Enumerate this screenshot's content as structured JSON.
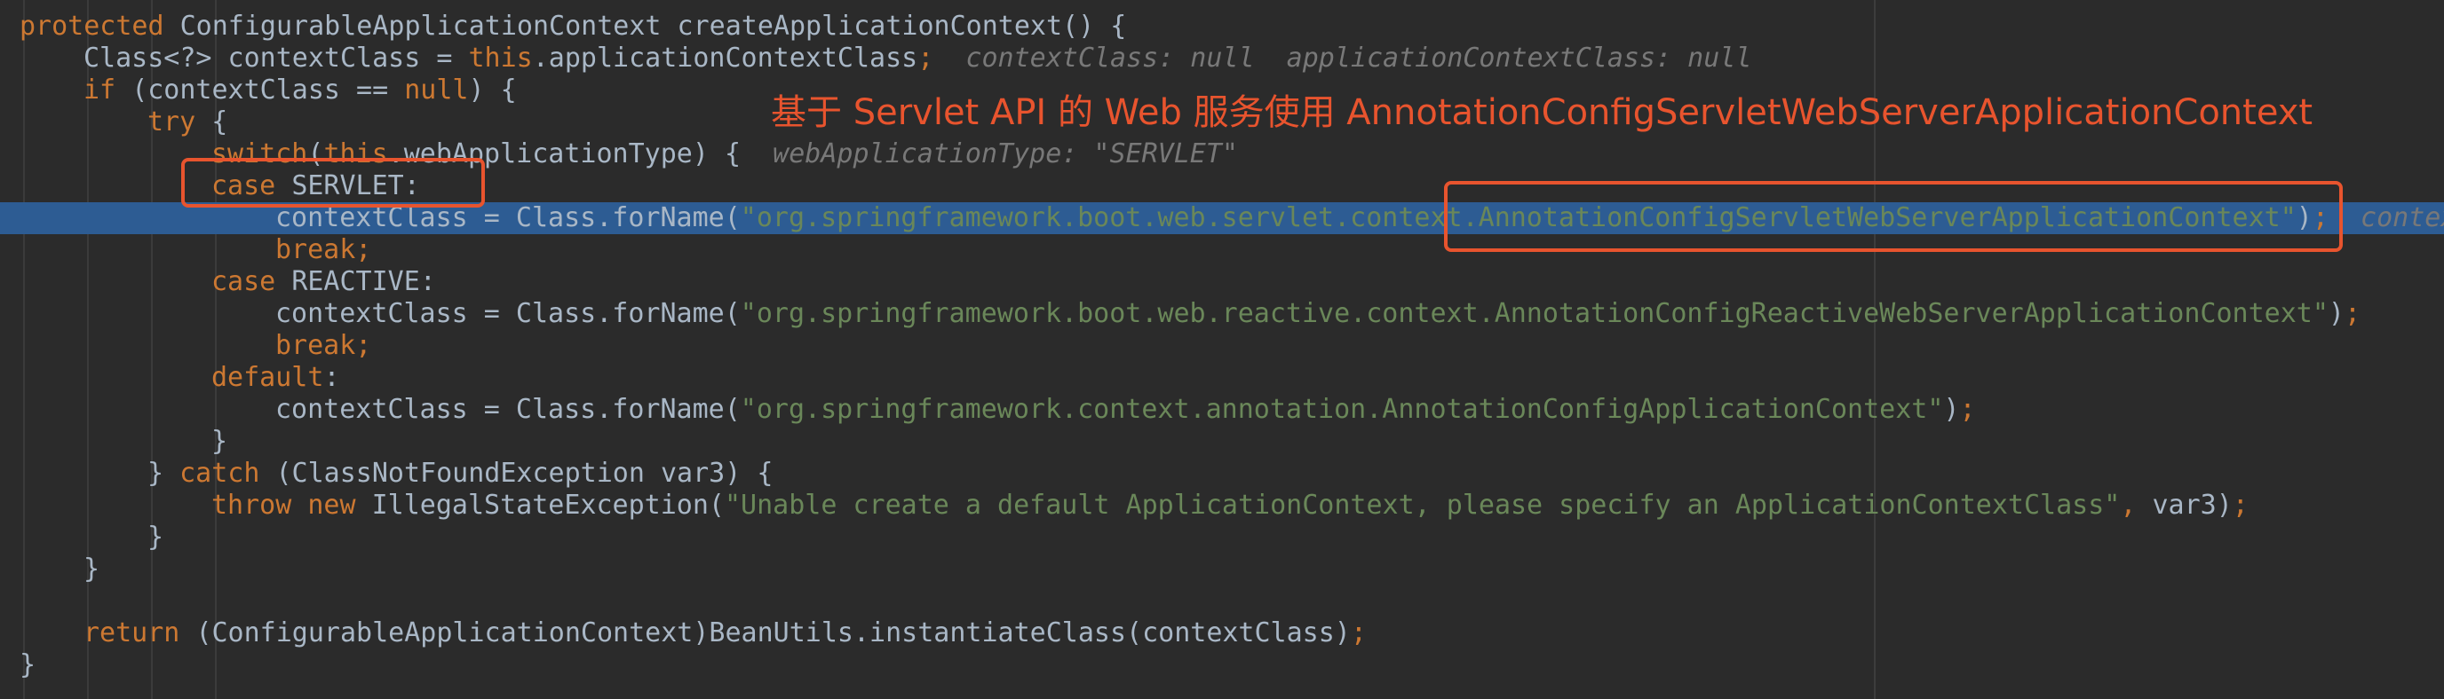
{
  "code_lines": [
    {
      "indent": 0,
      "parts": [
        [
          "kw",
          "protected "
        ],
        [
          "plain",
          "ConfigurableApplicationContext createApplicationContext() {"
        ]
      ]
    },
    {
      "indent": 1,
      "parts": [
        [
          "plain",
          "Class<?> contextClass = "
        ],
        [
          "kw",
          "this"
        ],
        [
          "plain",
          ".applicationContextClass"
        ],
        [
          "kw",
          ";"
        ],
        [
          "hint",
          "  contextClass: null  applicationContextClass: null"
        ]
      ]
    },
    {
      "indent": 1,
      "parts": [
        [
          "kw",
          "if "
        ],
        [
          "plain",
          "(contextClass == "
        ],
        [
          "kw",
          "null"
        ],
        [
          "plain",
          ") {"
        ]
      ]
    },
    {
      "indent": 2,
      "parts": [
        [
          "kw",
          "try "
        ],
        [
          "plain",
          "{"
        ]
      ]
    },
    {
      "indent": 3,
      "parts": [
        [
          "kw",
          "switch"
        ],
        [
          "plain",
          "("
        ],
        [
          "kw",
          "this"
        ],
        [
          "plain",
          ".webApplicationType) {"
        ],
        [
          "hint",
          "  webApplicationType: \"SERVLET\""
        ]
      ]
    },
    {
      "indent": 3,
      "parts": [
        [
          "kw",
          "case "
        ],
        [
          "plain",
          "SERVLET:"
        ]
      ]
    },
    {
      "indent": 4,
      "current": true,
      "parts": [
        [
          "plain",
          "contextClass = Class.forName("
        ],
        [
          "str",
          "\"org.springframework.boot.web.servlet.context.AnnotationConfigServletWebServerApplicationContext\""
        ],
        [
          "plain",
          ")"
        ],
        [
          "kw",
          ";"
        ],
        [
          "hint",
          "  contex"
        ]
      ]
    },
    {
      "indent": 4,
      "parts": [
        [
          "kw",
          "break;"
        ]
      ]
    },
    {
      "indent": 3,
      "parts": [
        [
          "kw",
          "case "
        ],
        [
          "plain",
          "REACTIVE:"
        ]
      ]
    },
    {
      "indent": 4,
      "parts": [
        [
          "plain",
          "contextClass = Class.forName("
        ],
        [
          "str",
          "\"org.springframework.boot.web.reactive.context.AnnotationConfigReactiveWebServerApplicationContext\""
        ],
        [
          "plain",
          ")"
        ],
        [
          "kw",
          ";"
        ]
      ]
    },
    {
      "indent": 4,
      "parts": [
        [
          "kw",
          "break;"
        ]
      ]
    },
    {
      "indent": 3,
      "parts": [
        [
          "kw",
          "default"
        ],
        [
          "plain",
          ":"
        ]
      ]
    },
    {
      "indent": 4,
      "parts": [
        [
          "plain",
          "contextClass = Class.forName("
        ],
        [
          "str",
          "\"org.springframework.context.annotation.AnnotationConfigApplicationContext\""
        ],
        [
          "plain",
          ")"
        ],
        [
          "kw",
          ";"
        ]
      ]
    },
    {
      "indent": 3,
      "parts": [
        [
          "plain",
          "}"
        ]
      ]
    },
    {
      "indent": 2,
      "parts": [
        [
          "plain",
          "} "
        ],
        [
          "kw",
          "catch "
        ],
        [
          "plain",
          "(ClassNotFoundException var3) {"
        ]
      ]
    },
    {
      "indent": 3,
      "parts": [
        [
          "kw",
          "throw new "
        ],
        [
          "plain",
          "IllegalStateException("
        ],
        [
          "str",
          "\"Unable create a default ApplicationContext, please specify an ApplicationContextClass\""
        ],
        [
          "kw",
          ", "
        ],
        [
          "plain",
          "var3)"
        ],
        [
          "kw",
          ";"
        ]
      ]
    },
    {
      "indent": 2,
      "parts": [
        [
          "plain",
          "}"
        ]
      ]
    },
    {
      "indent": 1,
      "parts": [
        [
          "plain",
          "}"
        ]
      ]
    },
    {
      "indent": 0,
      "parts": []
    },
    {
      "indent": 1,
      "parts": [
        [
          "kw",
          "return "
        ],
        [
          "plain",
          "(ConfigurableApplicationContext)BeanUtils.instantiateClass(contextClass)"
        ],
        [
          "kw",
          ";"
        ]
      ]
    },
    {
      "indent": 0,
      "parts": [
        [
          "plain",
          "}"
        ]
      ]
    }
  ],
  "annotation": {
    "callout_text": "基于 Servlet API 的 Web 服务使用 AnnotationConfigServletWebServerApplicationContext"
  },
  "colors": {
    "background": "#2b2b2b",
    "keyword": "#cc7832",
    "string": "#6a8759",
    "text": "#a9b7c6",
    "inline_hint": "#787878",
    "current_line": "#2d5c93",
    "annotation": "#e8542e"
  }
}
